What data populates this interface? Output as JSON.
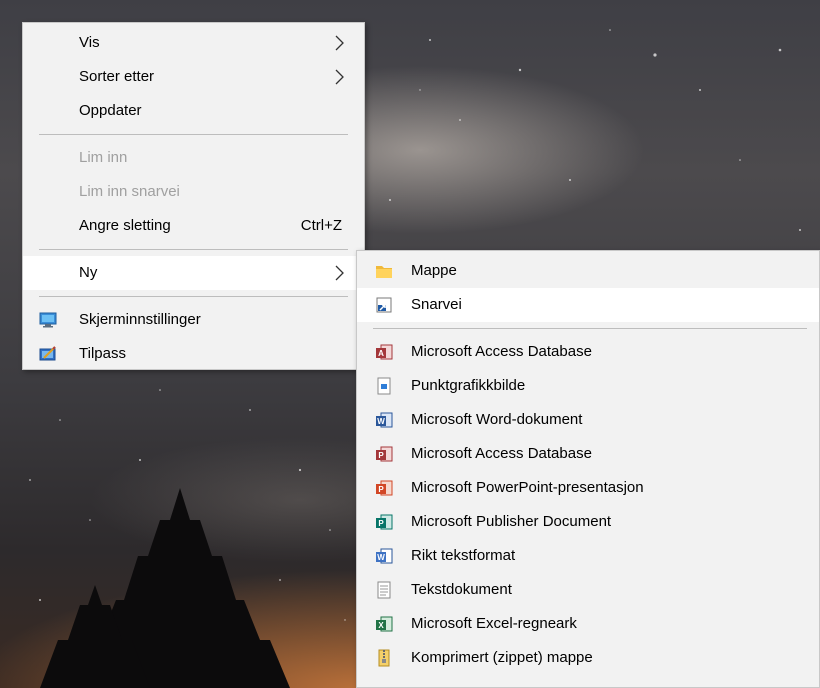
{
  "context_menu": {
    "items": [
      {
        "label": "Vis",
        "submenu": true
      },
      {
        "label": "Sorter etter",
        "submenu": true
      },
      {
        "label": "Oppdater"
      },
      {
        "label": "Lim inn",
        "disabled": true
      },
      {
        "label": "Lim inn snarvei",
        "disabled": true
      },
      {
        "label": "Angre sletting",
        "shortcut": "Ctrl+Z"
      },
      {
        "label": "Ny",
        "submenu": true,
        "highlighted": true
      },
      {
        "label": "Skjerminnstillinger",
        "icon": "display-settings-icon"
      },
      {
        "label": "Tilpass",
        "icon": "personalize-icon"
      }
    ]
  },
  "new_submenu": {
    "items": [
      {
        "label": "Mappe",
        "icon": "folder-icon"
      },
      {
        "label": "Snarvei",
        "icon": "shortcut-icon",
        "highlighted": true
      },
      {
        "label": "Microsoft Access Database",
        "icon": "access-icon"
      },
      {
        "label": "Punktgrafikkbilde",
        "icon": "bitmap-icon"
      },
      {
        "label": "Microsoft Word-dokument",
        "icon": "word-icon"
      },
      {
        "label": "Microsoft Access Database",
        "icon": "access-icon"
      },
      {
        "label": "Microsoft PowerPoint-presentasjon",
        "icon": "powerpoint-icon"
      },
      {
        "label": "Microsoft Publisher Document",
        "icon": "publisher-icon"
      },
      {
        "label": "Rikt tekstformat",
        "icon": "rtf-icon"
      },
      {
        "label": "Tekstdokument",
        "icon": "text-document-icon"
      },
      {
        "label": "Microsoft Excel-regneark",
        "icon": "excel-icon"
      },
      {
        "label": "Komprimert (zippet) mappe",
        "icon": "zip-folder-icon"
      }
    ]
  },
  "colors": {
    "menu_bg": "#f2f2f2",
    "highlight": "#ffffff",
    "disabled_text": "#a0a0a0",
    "access": "#a4373a",
    "word": "#2b579a",
    "powerpoint": "#d24726",
    "publisher": "#077568",
    "excel": "#217346",
    "folder": "#ffd35c"
  }
}
